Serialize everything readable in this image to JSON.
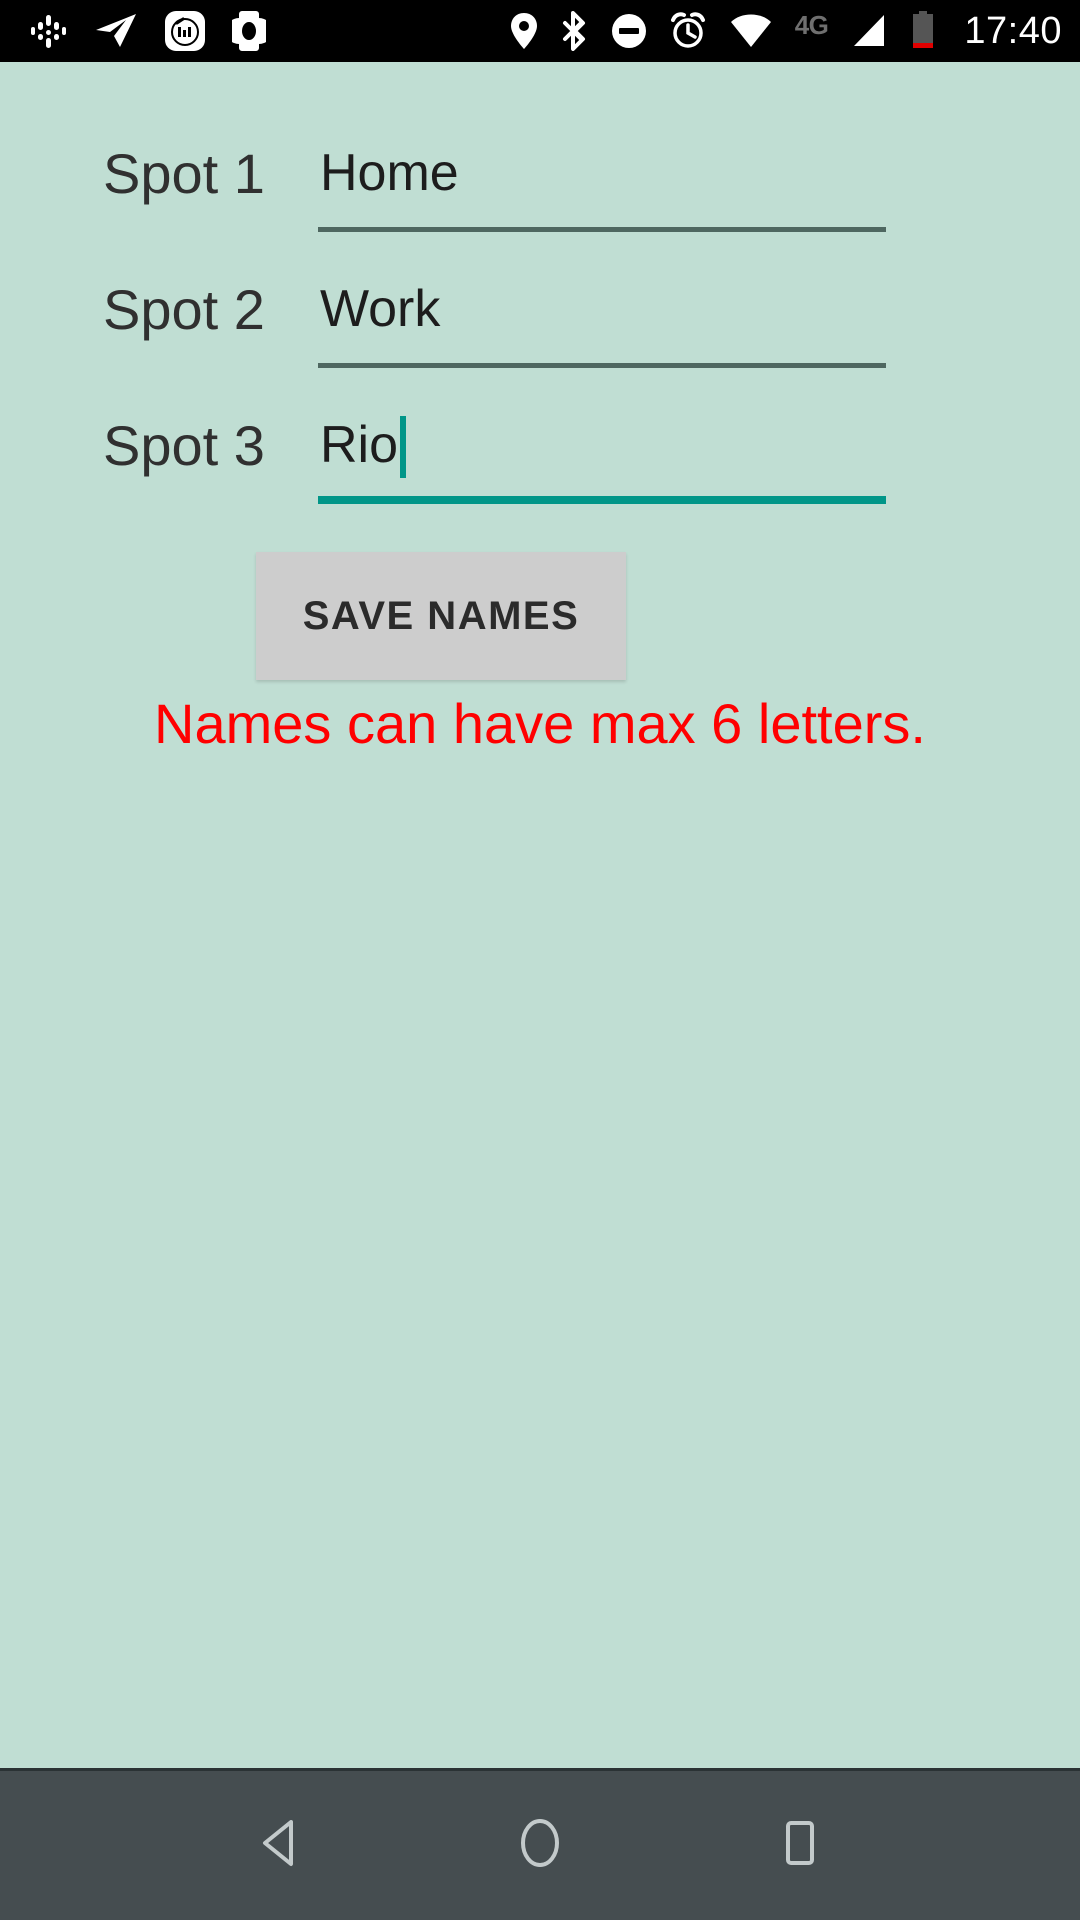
{
  "theme": {
    "background": "#c0ded3",
    "status_bar_bg": "#000000",
    "nav_bar_bg": "#454d50",
    "accent_teal": "#009688",
    "underline_idle": "#4e6760",
    "error_red": "#ff0000",
    "button_bg": "#cdcdcd",
    "label_color": "#303030"
  },
  "status_bar": {
    "notification_icons": [
      "podcast-icon",
      "telegram-icon",
      "mi-fit-icon",
      "mi-band-icon"
    ],
    "system_icons": [
      "location-icon",
      "bluetooth-icon",
      "do-not-disturb-icon",
      "alarm-icon",
      "wifi-icon"
    ],
    "network_type": "4G",
    "signal_icon": "cellular-signal-icon",
    "battery_icon": "battery-low-icon",
    "time": "17:40"
  },
  "form": {
    "rows": [
      {
        "label": "Spot 1",
        "value": "Home",
        "focused": false
      },
      {
        "label": "Spot 2",
        "value": "Work",
        "focused": false
      },
      {
        "label": "Spot 3",
        "value": "Rio",
        "focused": true
      }
    ]
  },
  "actions": {
    "save_label": "SAVE NAMES"
  },
  "messages": {
    "error": "Names can have max 6 letters."
  },
  "nav_bar": {
    "buttons": [
      {
        "name": "back",
        "icon": "back-triangle-icon"
      },
      {
        "name": "home",
        "icon": "home-circle-icon"
      },
      {
        "name": "recents",
        "icon": "recents-square-icon"
      }
    ]
  }
}
